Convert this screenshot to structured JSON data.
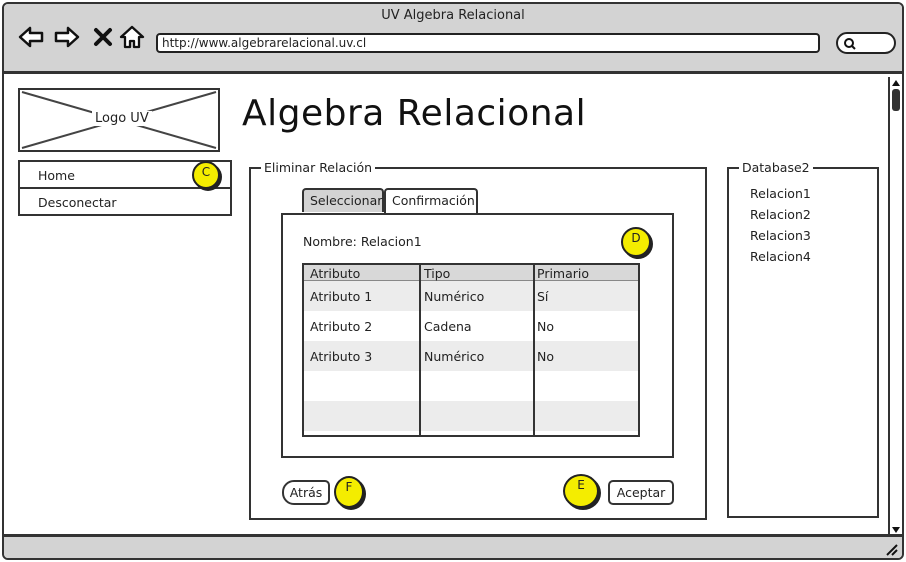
{
  "window": {
    "title": "UV Algebra Relacional"
  },
  "browser": {
    "url": "http://www.algebrarelacional.uv.cl",
    "icons": [
      "back-arrow-icon",
      "forward-arrow-icon",
      "close-icon",
      "home-icon",
      "search-icon"
    ]
  },
  "logo": {
    "label": "Logo UV"
  },
  "page": {
    "title": "Algebra Relacional"
  },
  "sidenav": {
    "items": [
      {
        "label": "Home"
      },
      {
        "label": "Desconectar"
      }
    ]
  },
  "annotations": {
    "c": "C",
    "d": "D",
    "e": "E",
    "f": "F"
  },
  "panel": {
    "legend": "Eliminar Relación",
    "tabs": [
      {
        "label": "Seleccionar"
      },
      {
        "label": "Confirmación"
      }
    ],
    "name_line": "Nombre: Relacion1",
    "table": {
      "headers": [
        "Atributo",
        "Tipo",
        "Primario"
      ],
      "rows": [
        [
          "Atributo 1",
          "Numérico",
          "Sí"
        ],
        [
          "Atributo 2",
          "Cadena",
          "No"
        ],
        [
          "Atributo 3",
          "Numérico",
          "No"
        ]
      ]
    },
    "buttons": {
      "back": "Atrás",
      "accept": "Aceptar"
    }
  },
  "database": {
    "legend": "Database2",
    "items": [
      "Relacion1",
      "Relacion2",
      "Relacion3",
      "Relacion4"
    ]
  },
  "colors": {
    "chrome": "#d3d3d3",
    "highlight": "#f4ed00",
    "stroke": "#333333"
  }
}
